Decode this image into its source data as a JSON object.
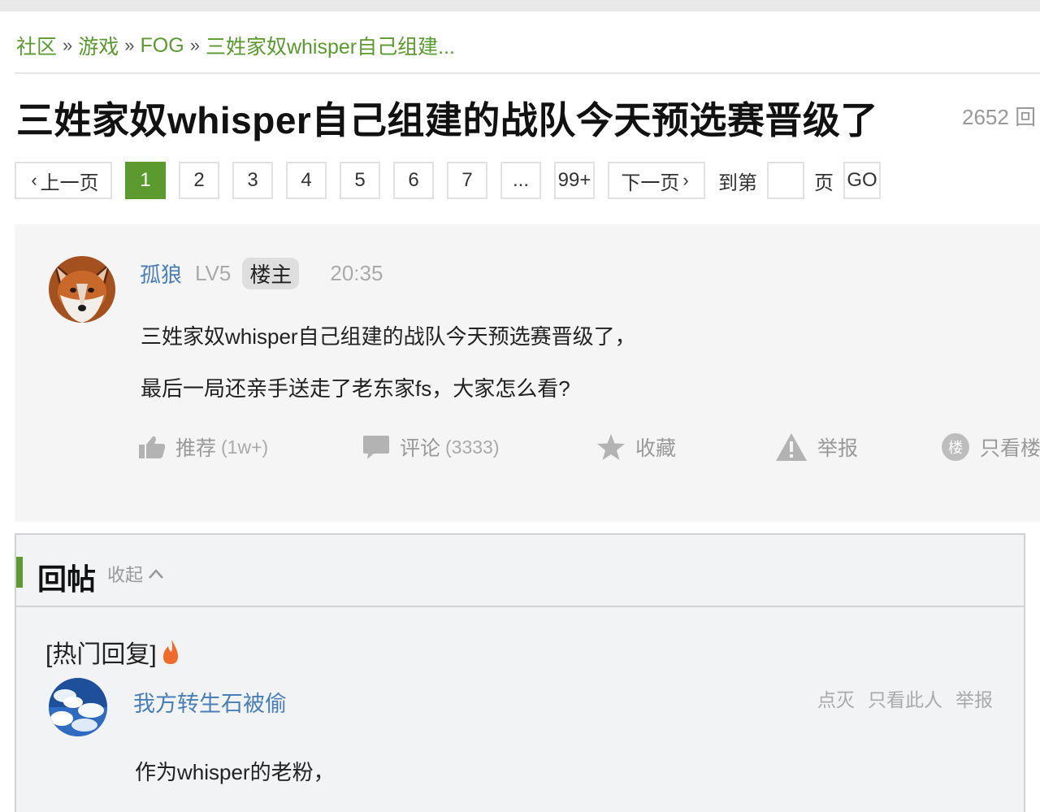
{
  "breadcrumb": {
    "items": [
      "社区",
      "游戏",
      "FOG",
      "三姓家奴whisper自己组建..."
    ],
    "separator": "»"
  },
  "thread": {
    "title": "三姓家奴whisper自己组建的战队今天预选赛晋级了",
    "reply_count": "2652 回"
  },
  "pagination": {
    "prev": "上一页",
    "pages": [
      "1",
      "2",
      "3",
      "4",
      "5",
      "6",
      "7",
      "...",
      "99+"
    ],
    "current": "1",
    "next": "下一页",
    "goto_prefix": "到第",
    "goto_suffix": "页",
    "go": "GO"
  },
  "post": {
    "author": "孤狼",
    "level": "LV5",
    "badge": "楼主",
    "time": "20:35",
    "body": [
      "三姓家奴whisper自己组建的战队今天预选赛晋级了，",
      "最后一局还亲手送走了老东家fs，大家怎么看?"
    ],
    "actions": {
      "recommend": "推荐",
      "recommend_count": "(1w+)",
      "comment": "评论",
      "comment_count": "(3333)",
      "favorite": "收藏",
      "report": "举报",
      "only_op": "只看楼"
    }
  },
  "replies": {
    "title": "回帖",
    "collapse": "收起",
    "hot_label": "[热门回复]",
    "items": [
      {
        "author": "我方转生石被偷",
        "text": "作为whisper的老粉，",
        "tools": [
          "点灭",
          "只看此人",
          "举报"
        ]
      }
    ]
  },
  "colors": {
    "accent_green": "#5a9a2e",
    "link_blue": "#4a7eb8",
    "muted": "#999999",
    "post_bg": "#f5f5f5"
  }
}
